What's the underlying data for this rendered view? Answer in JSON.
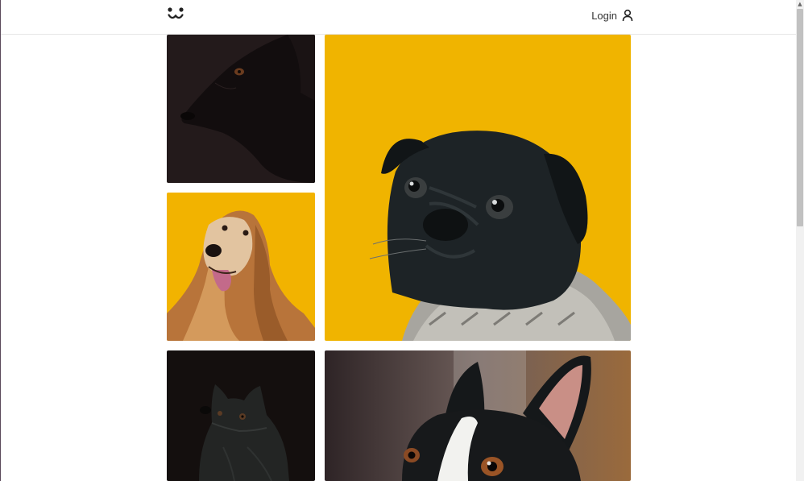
{
  "header": {
    "logo_icon": "dog-face-logo-icon",
    "login_label": "Login",
    "login_icon": "user-icon"
  },
  "gallery": {
    "tiles": [
      {
        "subject": "black-dog-dark-background",
        "background": "#231a1b"
      },
      {
        "subject": "black-pug-in-sweater",
        "background": "#f0b400"
      },
      {
        "subject": "afghan-hound-yellow-background",
        "background": "#f2b300"
      },
      {
        "subject": "black-fluffy-dog-dark-background",
        "background": "#140f0e"
      },
      {
        "subject": "boston-terrier",
        "background": "#4a3a36"
      }
    ]
  },
  "colors": {
    "border": "#e6e6e6",
    "text": "#333333"
  }
}
